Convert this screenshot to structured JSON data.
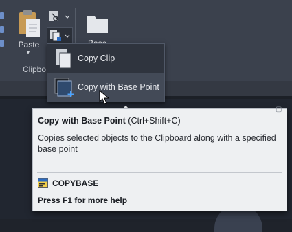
{
  "ribbon": {
    "paste": {
      "label": "Paste",
      "icon": "clipboard-paste-icon"
    },
    "panel_title": "Clipbo",
    "cut_icon": "cut-scissors-icon",
    "copy_icon": "copy-clip-icon",
    "base": {
      "label": "Base",
      "icon": "block-base-icon"
    }
  },
  "dropdown": {
    "items": [
      {
        "label": "Copy Clip",
        "icon": "copy-clip-icon"
      },
      {
        "label": "Copy with Base Point",
        "icon": "copy-base-point-icon"
      }
    ]
  },
  "tooltip": {
    "title": "Copy with Base Point",
    "shortcut": "(Ctrl+Shift+C)",
    "description": "Copies selected objects to the Clipboard along with a specified base point",
    "command": "COPYBASE",
    "help": "Press F1 for more help"
  },
  "colors": {
    "ribbon_bg": "#3b414d",
    "tooltip_bg": "#eef0f2",
    "menu_hover": "#434a57",
    "accent_blue": "#2d6cc0"
  }
}
